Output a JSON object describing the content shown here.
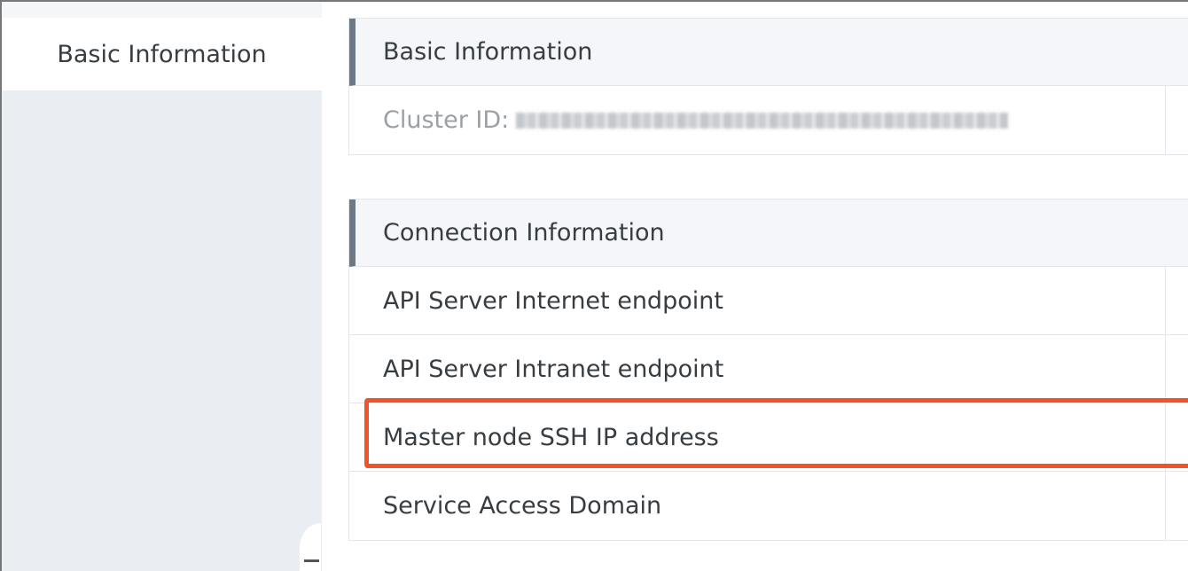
{
  "sidebar": {
    "active_item": "Basic Information"
  },
  "basic_info": {
    "header": "Basic Information",
    "cluster_id_label": "Cluster ID:"
  },
  "connection_info": {
    "header": "Connection Information",
    "rows": [
      "API Server Internet endpoint",
      "API Server Intranet endpoint",
      "Master node SSH IP address",
      "Service Access Domain"
    ]
  },
  "colors": {
    "highlight": "#f0542c",
    "header_accent": "#6d7a86",
    "sidebar_bg": "#eaedf1"
  }
}
